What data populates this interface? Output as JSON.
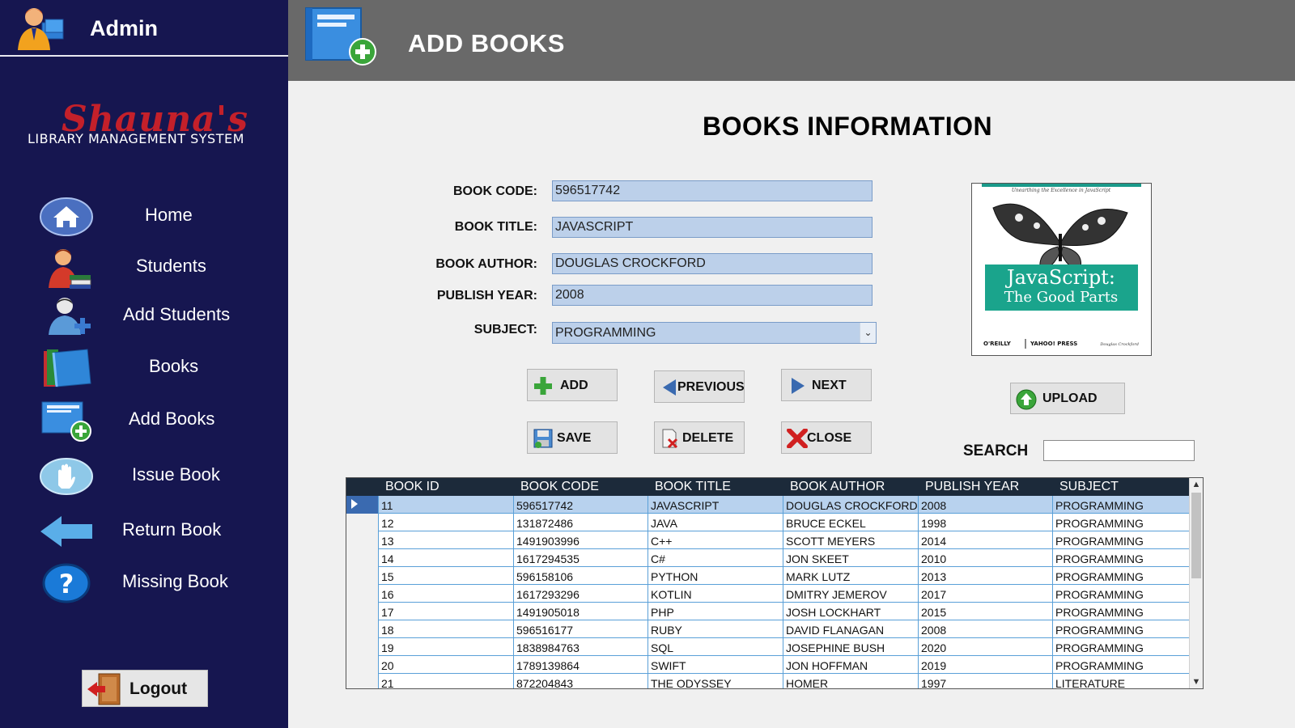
{
  "sidebar": {
    "admin_title": "Admin",
    "logo_script": "Shauna's",
    "logo_subtitle": "LIBRARY MANAGEMENT SYSTEM",
    "items": [
      {
        "label": "Home",
        "icon": "home-icon"
      },
      {
        "label": "Students",
        "icon": "student-icon"
      },
      {
        "label": "Add Students",
        "icon": "add-student-icon"
      },
      {
        "label": "Books",
        "icon": "books-icon"
      },
      {
        "label": "Add Books",
        "icon": "add-book-icon"
      },
      {
        "label": "Issue Book",
        "icon": "hand-icon"
      },
      {
        "label": "Return Book",
        "icon": "arrow-left-icon"
      },
      {
        "label": "Missing Book",
        "icon": "question-icon"
      }
    ],
    "logout_label": "Logout"
  },
  "header": {
    "title": "ADD BOOKS"
  },
  "main": {
    "section_title": "BOOKS INFORMATION",
    "form": {
      "book_code_label": "BOOK CODE:",
      "book_code_value": "596517742",
      "book_title_label": "BOOK TITLE:",
      "book_title_value": "JAVASCRIPT",
      "book_author_label": "BOOK AUTHOR:",
      "book_author_value": "DOUGLAS CROCKFORD",
      "publish_year_label": "PUBLISH YEAR:",
      "publish_year_value": "2008",
      "subject_label": "SUBJECT:",
      "subject_value": "PROGRAMMING"
    },
    "buttons": {
      "add": "ADD",
      "previous": "PREVIOUS",
      "next": "NEXT",
      "save": "SAVE",
      "delete": "DELETE",
      "close": "CLOSE",
      "upload": "UPLOAD"
    },
    "cover": {
      "tagline": "Unearthing the Excellence in JavaScript",
      "title_line1": "JavaScript:",
      "title_line2": "The Good Parts",
      "publisher": "O'REILLY",
      "copublisher": "YAHOO! PRESS",
      "author": "Douglas Crockford"
    },
    "search_label": "SEARCH",
    "search_value": ""
  },
  "grid": {
    "columns": [
      "BOOK ID",
      "BOOK CODE",
      "BOOK TITLE",
      "BOOK AUTHOR",
      "PUBLISH YEAR",
      "SUBJECT"
    ],
    "rows": [
      [
        "11",
        "596517742",
        "JAVASCRIPT",
        "DOUGLAS CROCKFORD",
        "2008",
        "PROGRAMMING"
      ],
      [
        "12",
        "131872486",
        "JAVA",
        "BRUCE ECKEL",
        "1998",
        "PROGRAMMING"
      ],
      [
        "13",
        "1491903996",
        "C++",
        "SCOTT MEYERS",
        "2014",
        "PROGRAMMING"
      ],
      [
        "14",
        "1617294535",
        "C#",
        "JON SKEET",
        "2010",
        "PROGRAMMING"
      ],
      [
        "15",
        "596158106",
        "PYTHON",
        "MARK LUTZ",
        "2013",
        "PROGRAMMING"
      ],
      [
        "16",
        "1617293296",
        "KOTLIN",
        "DMITRY JEMEROV",
        "2017",
        "PROGRAMMING"
      ],
      [
        "17",
        "1491905018",
        "PHP",
        "JOSH LOCKHART",
        "2015",
        "PROGRAMMING"
      ],
      [
        "18",
        "596516177",
        "RUBY",
        "DAVID FLANAGAN",
        "2008",
        "PROGRAMMING"
      ],
      [
        "19",
        "1838984763",
        "SQL",
        "JOSEPHINE BUSH",
        "2020",
        "PROGRAMMING"
      ],
      [
        "20",
        "1789139864",
        "SWIFT",
        "JON HOFFMAN",
        "2019",
        "PROGRAMMING"
      ],
      [
        "21",
        "872204843",
        "THE ODYSSEY",
        "HOMER",
        "1997",
        "LITERATURE"
      ]
    ],
    "selected_row": 0
  },
  "colors": {
    "sidebar_bg": "#161650",
    "header_bg": "#696969",
    "field_bg": "#bcd0ea",
    "grid_header_bg": "#1c2a3a",
    "selected_row_bg": "#b8d2ee"
  }
}
